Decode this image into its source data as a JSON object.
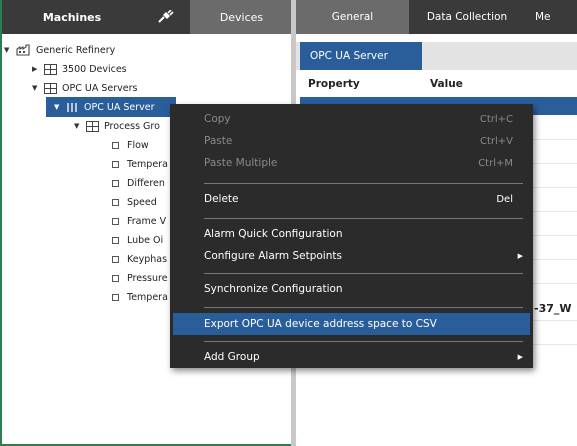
{
  "left_tabs": {
    "machines": "Machines",
    "plug_icon": "plug-icon",
    "devices": "Devices"
  },
  "tree": {
    "root": "Generic Refinery",
    "devices_3500": "3500 Devices",
    "opc_servers": "OPC UA Servers",
    "opc_server": "OPC UA Server",
    "process_group": "Process Gro",
    "items": [
      "Flow",
      "Tempera",
      "Differen",
      "Speed",
      "Frame V",
      "Lube Oi",
      "Keyphas",
      "Pressure",
      "Tempera"
    ]
  },
  "right_tabs": {
    "general": "General",
    "data_collection": "Data Collection",
    "more": "Me"
  },
  "panel": {
    "opc_tab": "OPC UA Server",
    "col_property": "Property",
    "col_value": "Value",
    "partial_value": "-37_W"
  },
  "context_menu": {
    "copy": "Copy",
    "copy_sc": "Ctrl+C",
    "paste": "Paste",
    "paste_sc": "Ctrl+V",
    "paste_multiple": "Paste Multiple",
    "paste_multiple_sc": "Ctrl+M",
    "delete": "Delete",
    "delete_sc": "Del",
    "alarm_quick": "Alarm Quick Configuration",
    "configure_alarm": "Configure Alarm Setpoints",
    "synchronize": "Synchronize Configuration",
    "export_csv": "Export OPC UA device address space to CSV",
    "add_group": "Add Group"
  },
  "colors": {
    "selection": "#2a5e9b",
    "menu_bg": "#2b2b2b",
    "tab_dark": "#3a3a3a",
    "tab_active": "#6b6b6b"
  }
}
